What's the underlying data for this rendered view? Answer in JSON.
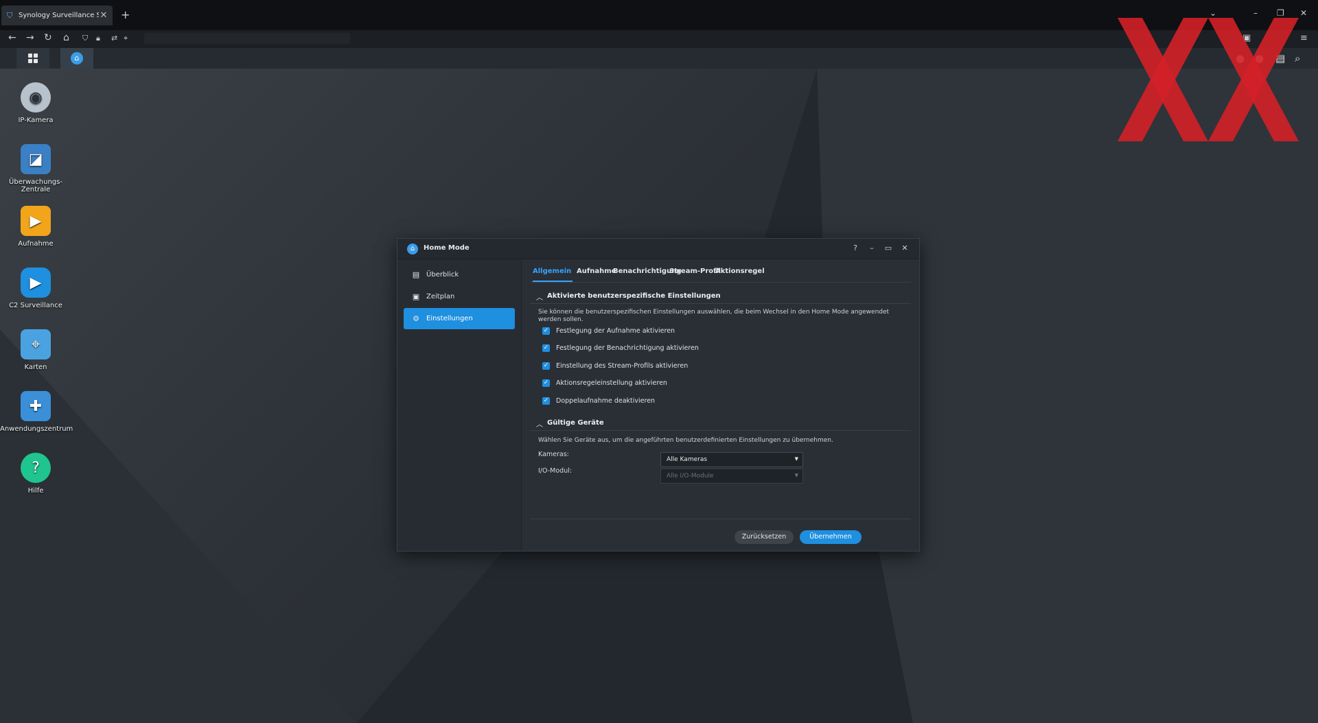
{
  "browser": {
    "tab_title": "Synology Surveillance Station -",
    "tab_close": "✕",
    "new_tab": "+"
  },
  "desktop_icons": [
    {
      "label": "IP-Kamera",
      "color": "#8c99a8"
    },
    {
      "label": "Überwachungs-Zentrale",
      "color": "#3b7fc4"
    },
    {
      "label": "Aufnahme",
      "color": "#f2a51a"
    },
    {
      "label": "C2 Surveillance",
      "color": "#1f8fe0"
    },
    {
      "label": "Karten",
      "color": "#4aa3e0"
    },
    {
      "label": "Anwendungszentrum",
      "color": "#3a8fd8"
    },
    {
      "label": "Hilfe",
      "color": "#1fc48e"
    }
  ],
  "dialog": {
    "title": "Home Mode",
    "help": "?",
    "sidebar": [
      {
        "label": "Überblick",
        "icon": "overview-icon"
      },
      {
        "label": "Zeitplan",
        "icon": "calendar-icon"
      },
      {
        "label": "Einstellungen",
        "icon": "gear-icon"
      }
    ],
    "tabs": [
      "Allgemein",
      "Aufnahme",
      "Benachrichtigung",
      "Stream-Profil",
      "Aktionsregel"
    ],
    "section1": {
      "title": "Aktivierte benutzerspezifische Einstellungen",
      "description": "Sie können die benutzerspezifischen Einstellungen auswählen, die beim Wechsel in den Home Mode angewendet werden sollen.",
      "checkboxes": [
        "Festlegung der Aufnahme aktivieren",
        "Festlegung der Benachrichtigung aktivieren",
        "Einstellung des Stream-Profils aktivieren",
        "Aktionsregeleinstellung aktivieren",
        "Doppelaufnahme deaktivieren"
      ]
    },
    "section2": {
      "title": "Gültige Geräte",
      "description": "Wählen Sie Geräte aus, um die angeführten benutzerdefinierten Einstellungen zu übernehmen.",
      "cameras_label": "Kameras:",
      "cameras_value": "Alle Kameras",
      "io_label": "I/O-Modul:",
      "io_value": "Alle I/O-Module"
    },
    "buttons": {
      "reset": "Zurücksetzen",
      "apply": "Übernehmen"
    }
  },
  "colors": {
    "accent": "#1f8fe0",
    "watermark": "#d32027"
  }
}
